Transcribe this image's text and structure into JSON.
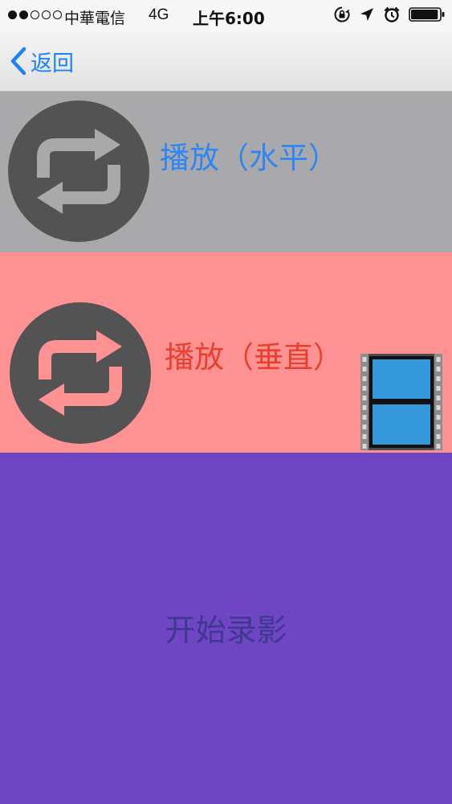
{
  "status_bar": {
    "carrier": "中華電信",
    "network": "4G",
    "time": "上午6:00",
    "signal_bars_filled": 2,
    "signal_bars_total": 5,
    "battery_level": 0.95
  },
  "nav_bar": {
    "back_label": "返回",
    "accent_color": "#1a82fb"
  },
  "rows": {
    "horizontal": {
      "label": "播放（水平）",
      "icon": "repeat-icon",
      "background": "#a9a9ab",
      "text_color": "#2d86f4"
    },
    "vertical": {
      "label": "播放（垂直）",
      "icon": "repeat-icon",
      "badge_icon": "film-strip-icon",
      "background": "#fe9292",
      "text_color": "#e8402f"
    },
    "record": {
      "label": "开始录影",
      "background": "#6e45c2",
      "text_color": "#3f3891"
    }
  }
}
